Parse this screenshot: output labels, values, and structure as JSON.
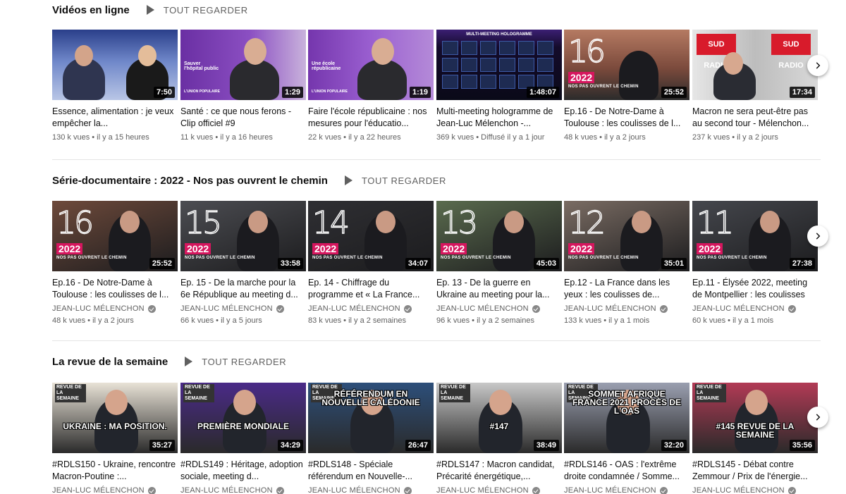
{
  "shelves": [
    {
      "title": "Vidéos en ligne",
      "play_all": "TOUT REGARDER",
      "videos": [
        {
          "title": "Essence, alimentation : je veux empêcher la...",
          "duration": "7:50",
          "views": "130 k vues",
          "age": "il y a 15 heures",
          "channel": "",
          "thumb": "tv"
        },
        {
          "title": "Santé : ce que nous ferons - Clip officiel #9",
          "duration": "1:29",
          "views": "11 k vues",
          "age": "il y a 16 heures",
          "channel": "",
          "thumb": "purple"
        },
        {
          "title": "Faire l'école républicaine : nos mesures pour l'éducatio...",
          "duration": "1:19",
          "views": "22 k vues",
          "age": "il y a 22 heures",
          "channel": "",
          "thumb": "purple2"
        },
        {
          "title": "Multi-meeting hologramme de Jean-Luc Mélenchon -...",
          "duration": "1:48:07",
          "views": "369 k vues",
          "age": "Diffusé il y a 1 jour",
          "channel": "",
          "thumb": "holo"
        },
        {
          "title": "Ep.16 - De Notre-Dame à Toulouse : les coulisses de l...",
          "duration": "25:52",
          "views": "48 k vues",
          "age": "il y a 2 jours",
          "channel": "",
          "thumb": "ep16"
        },
        {
          "title": "Macron ne sera peut-être pas au second tour - Mélenchon...",
          "duration": "17:34",
          "views": "237 k vues",
          "age": "il y a 2 jours",
          "channel": "",
          "thumb": "sud"
        }
      ]
    },
    {
      "title": "Série-documentaire : 2022 - Nos pas ouvrent le chemin",
      "play_all": "TOUT REGARDER",
      "videos": [
        {
          "title": "Ep.16 - De Notre-Dame à Toulouse : les coulisses de l...",
          "duration": "25:52",
          "views": "48 k vues",
          "age": "il y a 2 jours",
          "channel": "JEAN-LUC MÉLENCHON",
          "thumb": "ep",
          "num": "16"
        },
        {
          "title": "Ep. 15 - De la marche pour la 6e République au meeting d...",
          "duration": "33:58",
          "views": "66 k vues",
          "age": "il y a 5 jours",
          "channel": "JEAN-LUC MÉLENCHON",
          "thumb": "ep",
          "num": "15"
        },
        {
          "title": "Ep. 14 - Chiffrage du programme et « La France...",
          "duration": "34:07",
          "views": "83 k vues",
          "age": "il y a 2 semaines",
          "channel": "JEAN-LUC MÉLENCHON",
          "thumb": "ep",
          "num": "14"
        },
        {
          "title": "Ep. 13 - De la guerre en Ukraine au meeting pour la...",
          "duration": "45:03",
          "views": "96 k vues",
          "age": "il y a 2 semaines",
          "channel": "JEAN-LUC MÉLENCHON",
          "thumb": "ep",
          "num": "13"
        },
        {
          "title": "Ep.12 - La France dans les yeux : les coulisses de...",
          "duration": "35:01",
          "views": "133 k vues",
          "age": "il y a 1 mois",
          "channel": "JEAN-LUC MÉLENCHON",
          "thumb": "ep",
          "num": "12"
        },
        {
          "title": "Ep.11 - Élysée 2022, meeting de Montpellier : les coulisses",
          "duration": "27:38",
          "views": "60 k vues",
          "age": "il y a 1 mois",
          "channel": "JEAN-LUC MÉLENCHON",
          "thumb": "ep",
          "num": "11"
        }
      ]
    },
    {
      "title": "La revue de la semaine",
      "play_all": "TOUT REGARDER",
      "videos": [
        {
          "title": "#RDLS150 - Ukraine, rencontre Macron-Poutine :...",
          "duration": "35:27",
          "channel": "JEAN-LUC MÉLENCHON",
          "thumb": "rev",
          "caption": "UKRAINE : MA POSITION."
        },
        {
          "title": "#RDLS149 : Héritage, adoption sociale, meeting d...",
          "duration": "34:29",
          "channel": "JEAN-LUC MÉLENCHON",
          "thumb": "rev",
          "caption": "PREMIÈRE MONDIALE"
        },
        {
          "title": "#RDLS148 - Spéciale référendum en Nouvelle-...",
          "duration": "26:47",
          "channel": "JEAN-LUC MÉLENCHON",
          "thumb": "rev",
          "caption": "RÉFÉRENDUM EN NOUVELLE CALÉDONIE"
        },
        {
          "title": "#RDLS147 : Macron candidat, Précarité énergétique,...",
          "duration": "38:49",
          "channel": "JEAN-LUC MÉLENCHON",
          "thumb": "rev",
          "caption": "#147"
        },
        {
          "title": "#RDLS146 - OAS : l'extrême droite condamnée / Somme...",
          "duration": "32:20",
          "channel": "JEAN-LUC MÉLENCHON",
          "thumb": "rev",
          "caption": "SOMMET AFRIQUE FRANCE 2021 PROCÈS DE L'OAS"
        },
        {
          "title": "#RDLS145 - Débat contre Zemmour / Prix de l'énergie...",
          "duration": "35:56",
          "channel": "JEAN-LUC MÉLENCHON",
          "thumb": "rev",
          "caption": "#145 REVUE DE LA SEMAINE"
        }
      ]
    }
  ],
  "labels": {
    "ep_series_tag": "NOS PAS OUVRENT LE CHEMIN",
    "ep_year": "2022",
    "revue_tag": "REVUE DE LA SEMAINE",
    "holo_title": "MULTI-MEETING HOLOGRAMME",
    "sud_logo": "SUD RADIO",
    "purple_caption_1": "Sauver l'hôpital public",
    "purple_caption_2": "Une école républicaine",
    "union_pop": "L'UNION POPULAIRE"
  },
  "colors": {
    "accent_pink": "#d6165e",
    "purple": "#7b3fb0",
    "revue_blue": "#1a2f80",
    "text_secondary": "#606060"
  }
}
